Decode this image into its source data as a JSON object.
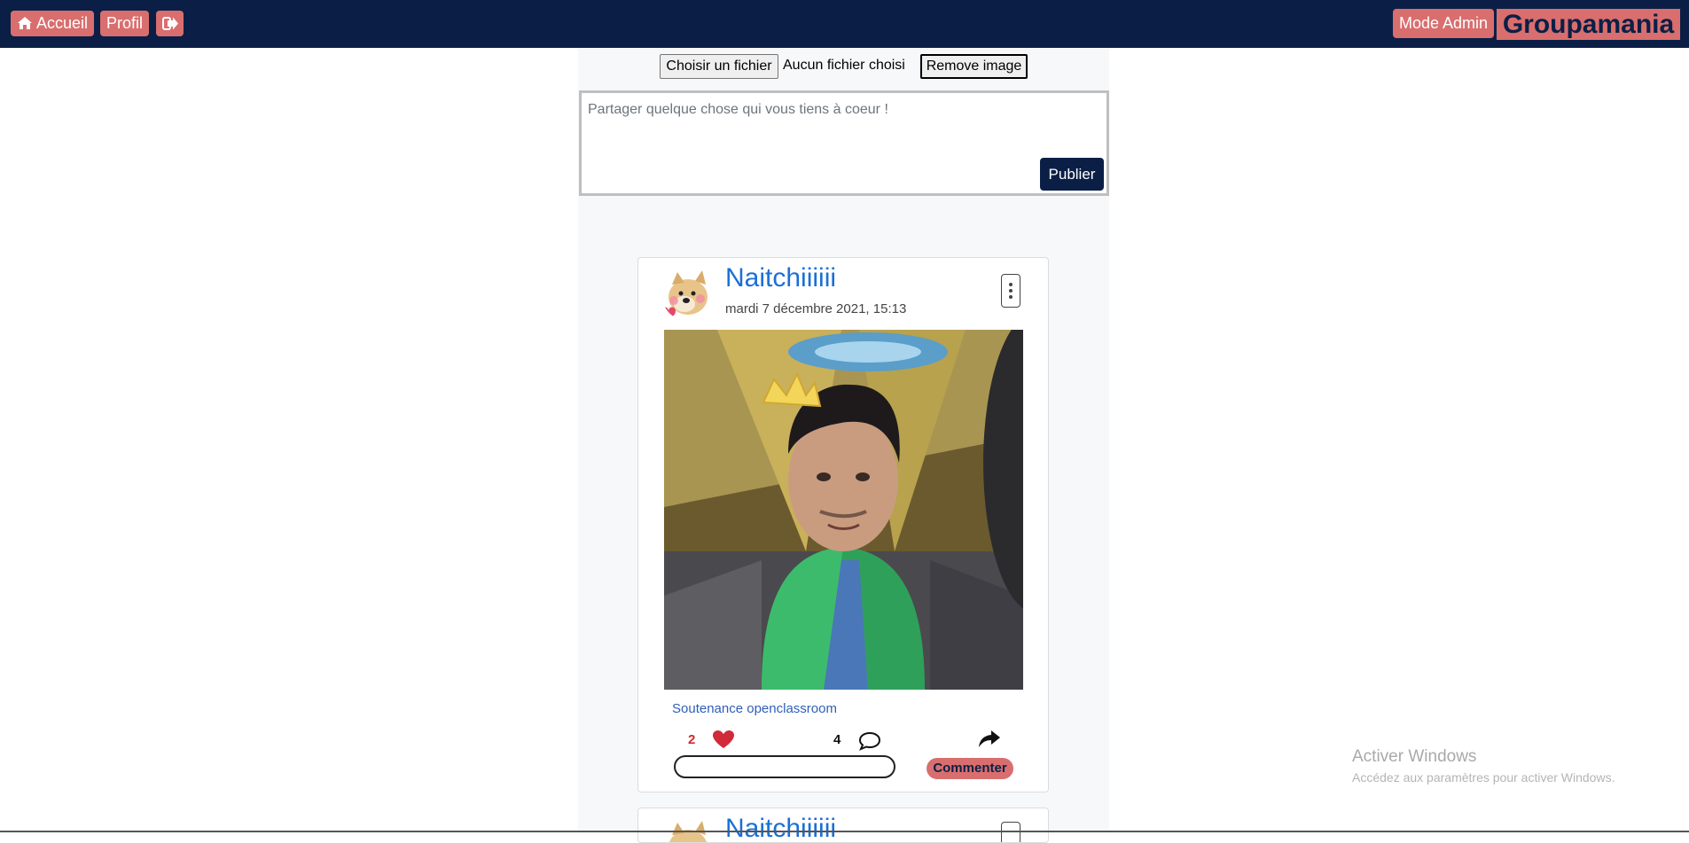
{
  "navbar": {
    "home_label": "Accueil",
    "profile_label": "Profil",
    "admin_label": "Mode Admin",
    "brand": "Groupamania",
    "colors": {
      "bar": "#0b1f46",
      "button": "#d96e6e"
    }
  },
  "upload": {
    "choose_label": "Choisir un fichier",
    "status": "Aucun fichier choisi",
    "remove_label": "Remove image"
  },
  "composer": {
    "placeholder": "Partager quelque chose qui vous tiens à coeur !",
    "publish_label": "Publier"
  },
  "posts": [
    {
      "author": "Naitchiiiiii",
      "date": "mardi 7 décembre 2021, 15:13",
      "caption": "Soutenance openclassroom",
      "likes": "2",
      "comments": "4",
      "comment_button": "Commenter"
    },
    {
      "author": "Naitchiiiiii"
    }
  ],
  "windows_watermark": {
    "title": "Activer Windows",
    "subtitle": "Accédez aux paramètres pour activer Windows."
  },
  "icons": [
    "home-icon",
    "logout-icon",
    "heart-icon",
    "speech-bubble-icon",
    "share-icon",
    "kebab-menu-icon"
  ]
}
